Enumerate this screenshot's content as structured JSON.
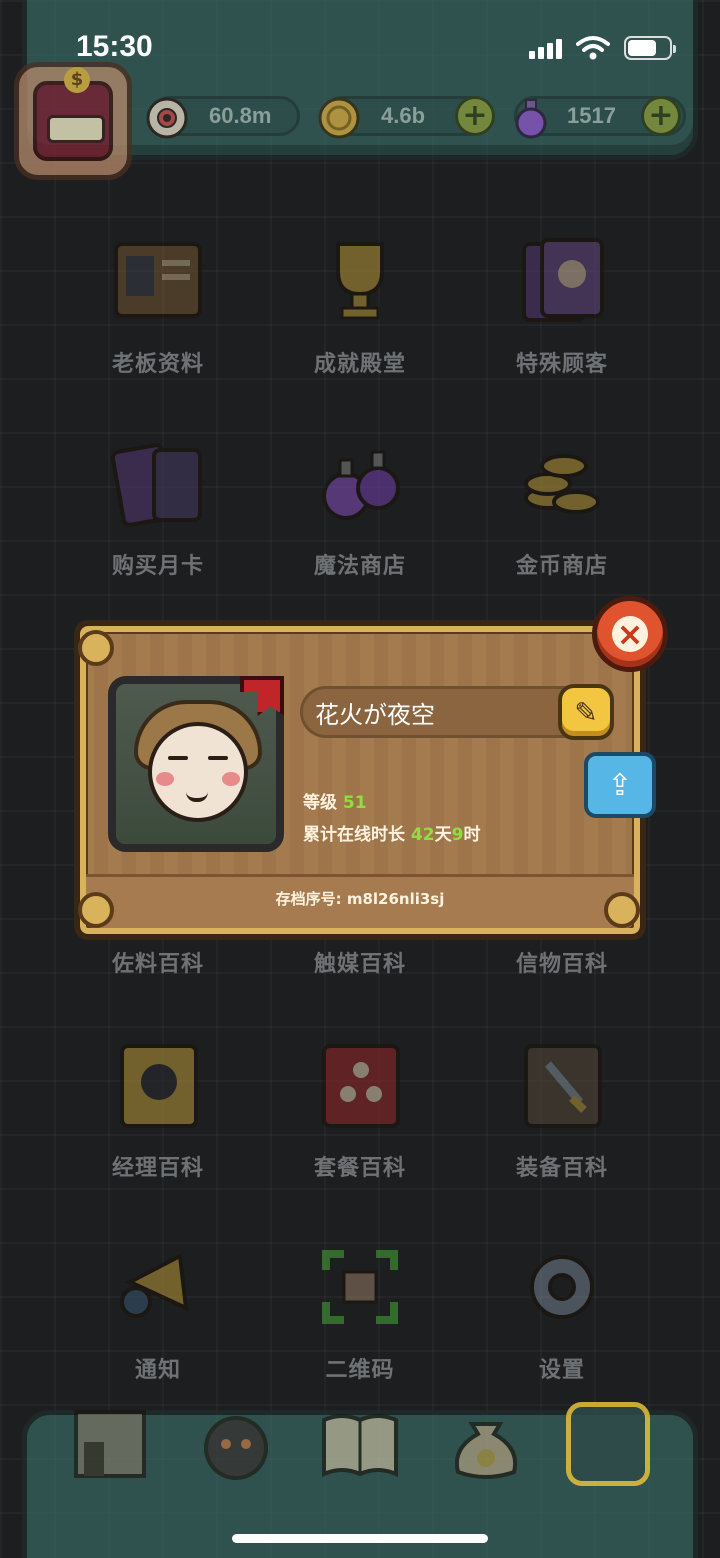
{
  "status_bar": {
    "time": "15:30"
  },
  "currencies": [
    {
      "name": "eyeball",
      "value": "60.8m"
    },
    {
      "name": "coin",
      "value": "4.6b"
    },
    {
      "name": "potion",
      "value": "1517"
    }
  ],
  "menu": {
    "row1": [
      "老板资料",
      "成就殿堂",
      "特殊顾客"
    ],
    "row2": [
      "购买月卡",
      "魔法商店",
      "金币商店"
    ],
    "row3": [
      "佐料百科",
      "触媒百科",
      "信物百科"
    ],
    "row4": [
      "经理百科",
      "套餐百科",
      "装备百科"
    ],
    "row5": [
      "通知",
      "二维码",
      "设置"
    ]
  },
  "profile": {
    "name": "花火が夜空",
    "level_label": "等级",
    "level_value": "51",
    "online_label": "累计在线时长",
    "online_days": "42",
    "online_days_unit": "天",
    "online_hours": "9",
    "online_hours_unit": "时",
    "save_id": "存档序号: m8l26nli3sj"
  },
  "colors": {
    "accent_green": "#8fe03e",
    "dialog_wood": "#a47a4f",
    "close_red": "#e0532f",
    "edit_yellow": "#f2c640",
    "share_blue": "#56b6e6"
  },
  "bottom_nav": [
    "shop-icon",
    "monster-icon",
    "book-icon",
    "money-bag-icon",
    "grid-menu-icon"
  ]
}
